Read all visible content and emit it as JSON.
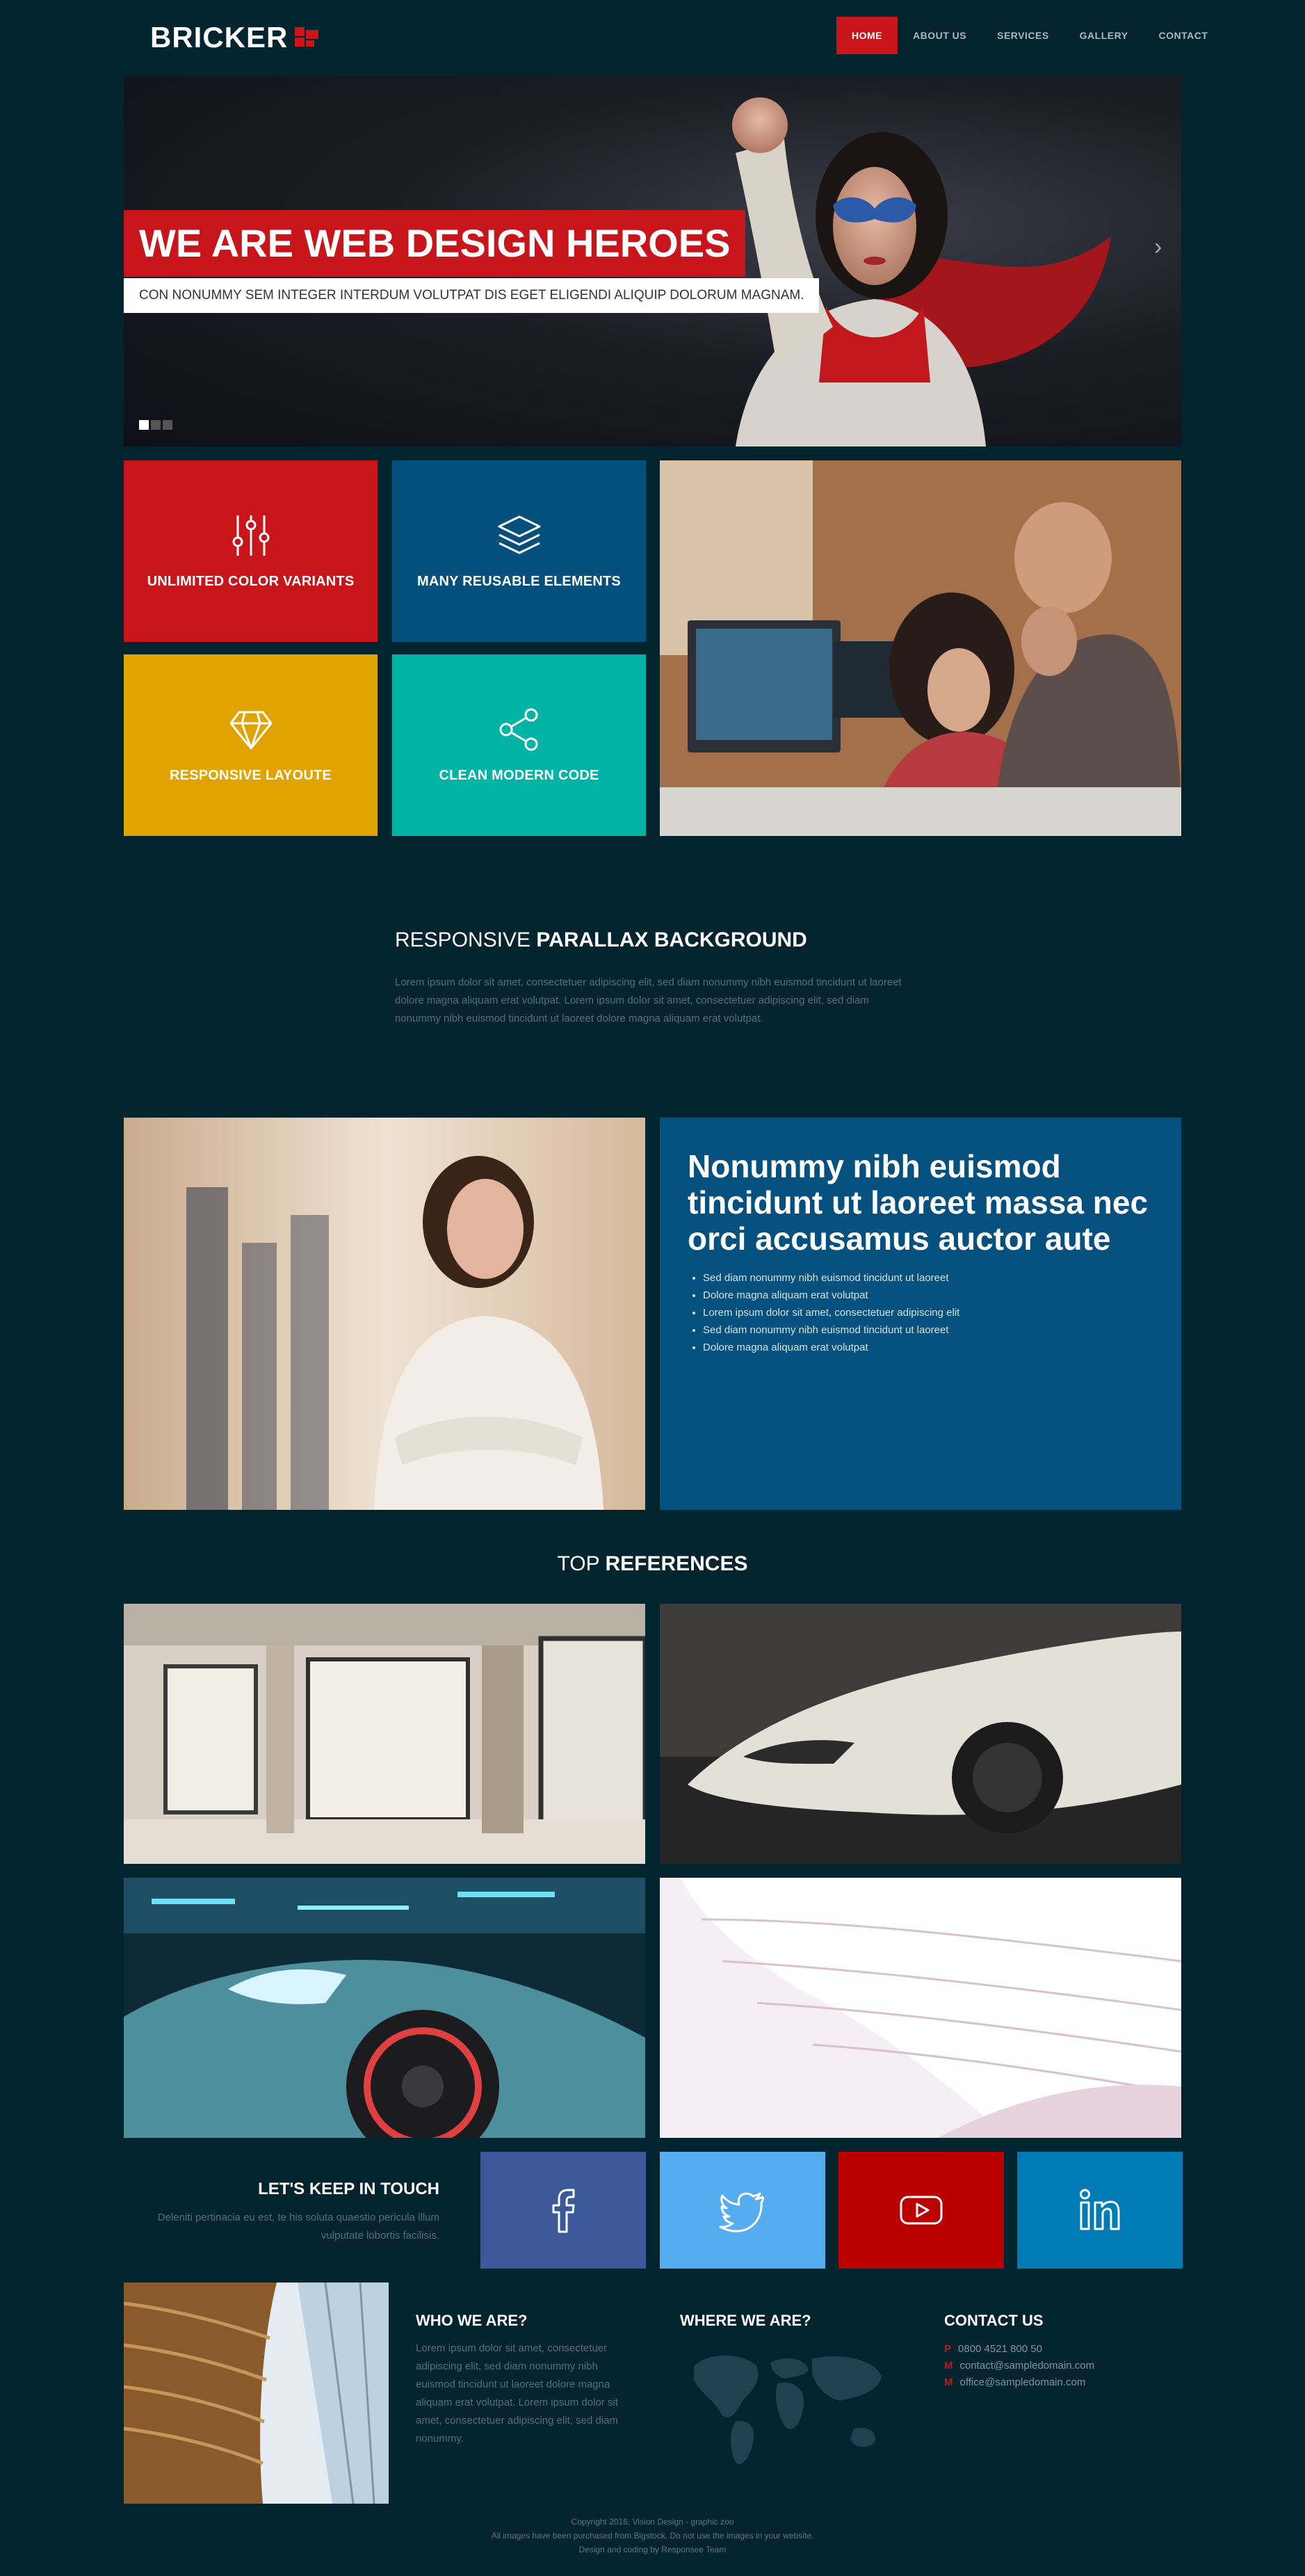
{
  "brand": {
    "name": "BRICKER"
  },
  "nav": {
    "items": [
      "HOME",
      "ABOUT US",
      "SERVICES",
      "GALLERY",
      "CONTACT"
    ],
    "active": "HOME"
  },
  "hero": {
    "title": "WE ARE WEB DESIGN HEROES",
    "subtitle": "CON NONUMMY SEM INTEGER INTERDUM VOLUTPAT DIS EGET ELIGENDI ALIQUIP DOLORUM MAGNAM.",
    "slide_count": 3,
    "active_slide": 1
  },
  "features": [
    {
      "label": "UNLIMITED COLOR VARIANTS",
      "icon": "sliders-icon",
      "color": "#c8141b"
    },
    {
      "label": "MANY REUSABLE ELEMENTS",
      "icon": "layers-icon",
      "color": "#03507d"
    },
    {
      "label": "RESPONSIVE LAYOUTE",
      "icon": "diamond-icon",
      "color": "#e0a300"
    },
    {
      "label": "CLEAN MODERN CODE",
      "icon": "share-icon",
      "color": "#00b3a5"
    }
  ],
  "parallax": {
    "title_light": "RESPONSIVE ",
    "title_bold": "PARALLAX BACKGROUND",
    "text": "Lorem ipsum dolor sit amet, consectetuer adipiscing elit, sed diam nonummy nibh euismod tincidunt ut laoreet dolore magna aliquam erat volutpat. Lorem ipsum dolor sit amet, consectetuer adipiscing elit, sed diam nonummy nibh euismod tincidunt ut laoreet dolore magna aliquam erat volutpat."
  },
  "info": {
    "title": "Nonummy nibh euismod tincidunt ut laoreet massa nec orci accusamus auctor aute",
    "list": [
      "Sed diam nonummy nibh euismod tincidunt ut laoreet",
      "Dolore magna aliquam erat volutpat",
      "Lorem ipsum dolor sit amet, consectetuer adipiscing elit",
      "Sed diam nonummy nibh euismod tincidunt ut laoreet",
      "Dolore magna aliquam erat volutpat"
    ]
  },
  "references": {
    "title_light": "TOP ",
    "title_bold": "REFERENCES"
  },
  "touch": {
    "title": "LET'S KEEP IN TOUCH",
    "text": "Deleniti pertinacia eu est, te his soluta quaestio pericula illum vulputate lobortis facilisis.",
    "networks": [
      {
        "name": "facebook-icon",
        "color": "#3b5998"
      },
      {
        "name": "twitter-icon",
        "color": "#55acee"
      },
      {
        "name": "youtube-icon",
        "color": "#bb0000"
      },
      {
        "name": "linkedin-icon",
        "color": "#007bb5"
      }
    ]
  },
  "footer": {
    "who_title": "WHO WE ARE?",
    "who_text": "Lorem ipsum dolor sit amet, consectetuer adipiscing elit, sed diam nonummy nibh euismod tincidunt ut laoreet dolore magna aliquam erat volutpat. Lorem ipsum dolor sit amet, consectetuer adipiscing elit, sed diam nonummy.",
    "where_title": "WHERE WE ARE?",
    "contact_title": "CONTACT US",
    "contacts": [
      {
        "key": "P",
        "value": "0800 4521 800 50"
      },
      {
        "key": "M",
        "value": "contact@sampledomain.com"
      },
      {
        "key": "M",
        "value": "office@sampledomain.com"
      }
    ],
    "copyright_1": "Copyright 2016, Vision Design - graphic zoo",
    "copyright_2": "All images have been purchased from Bigstock. Do not use the images in your website.",
    "copyright_3": "Design and coding by Responsee Team"
  }
}
